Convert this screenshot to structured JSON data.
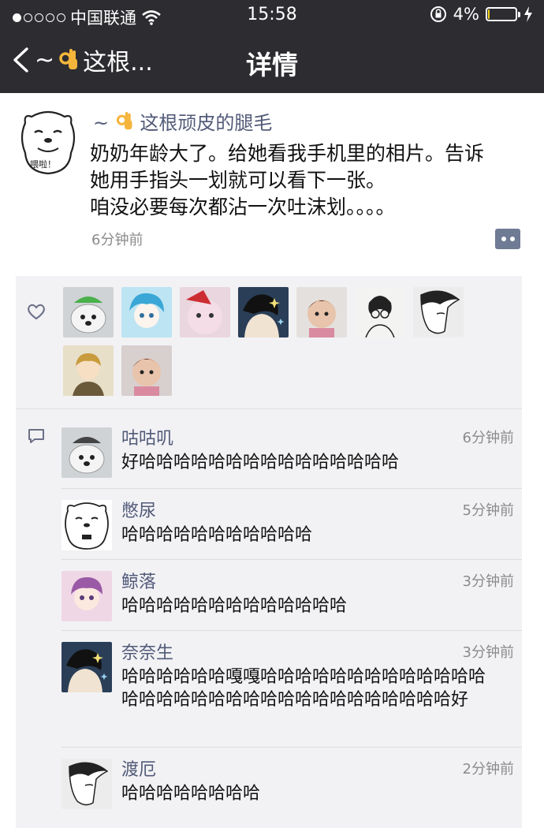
{
  "status_bar": {
    "carrier": "中国联通",
    "time": "15:58",
    "battery_percent": "4%",
    "battery_level": 0.04,
    "signal_bars_filled": 1,
    "signal_bars_total": 5,
    "icons": [
      "signal-dots-icon",
      "wifi-icon",
      "rotation-lock-icon",
      "battery-icon",
      "charging-bolt-icon"
    ]
  },
  "nav": {
    "back_prefix": "~",
    "back_label": "这根...",
    "title": "详情",
    "back_icon": "chevron-left-icon",
    "emoji_icon": "ok-hand-icon"
  },
  "post": {
    "author_prefix": "~",
    "author_name": "这根顽皮的腿毛",
    "avatar_text": "喂啦！",
    "lines": [
      "奶奶年龄大了。给她看我手机里的相片。告诉",
      "她用手指头一划就可以看下一张。",
      "咱没必要每次都沾一次吐沫划。。。。"
    ],
    "time": "6分钟前",
    "more_icon": "comment-more-icon"
  },
  "likes": {
    "icon": "heart-icon",
    "avatars": [
      {
        "name": "dog-green-hat-avatar",
        "bg": "#cfd3d6",
        "accent": "#49b04a"
      },
      {
        "name": "anime-blue-hair-avatar",
        "bg": "#bde4f2",
        "accent": "#3aa7d6"
      },
      {
        "name": "plush-bear-santa-avatar",
        "bg": "#ead6de",
        "accent": "#cc2d32"
      },
      {
        "name": "dark-hair-boy-avatar",
        "bg": "#2a3e57",
        "accent": "#e8d5c0"
      },
      {
        "name": "baby-photo-avatar",
        "bg": "#e4e0de",
        "accent": "#3b2c24"
      },
      {
        "name": "glasses-boy-sketch-avatar",
        "bg": "#f3f3f2",
        "accent": "#222222"
      },
      {
        "name": "anime-profile-avatar",
        "bg": "#ececec",
        "accent": "#2b2b2b"
      },
      {
        "name": "blonde-uniform-avatar",
        "bg": "#e8dfc8",
        "accent": "#c89b3c"
      },
      {
        "name": "child-photo-avatar",
        "bg": "#d8cfcf",
        "accent": "#5b3a33"
      }
    ]
  },
  "comments": {
    "icon": "comment-bubble-icon",
    "items": [
      {
        "name": "咕咕叽",
        "time": "6分钟前",
        "text": "好哈哈哈哈哈哈哈哈哈哈哈哈哈哈哈",
        "avatar": "dog-green-hat-avatar",
        "avatar_bg": "#cfd3d6"
      },
      {
        "name": "憋尿",
        "time": "5分钟前",
        "text": "哈哈哈哈哈哈哈哈哈哈哈",
        "avatar": "meme-bear-avatar",
        "avatar_bg": "#ffffff"
      },
      {
        "name": "鲸落",
        "time": "3分钟前",
        "text": "哈哈哈哈哈哈哈哈哈哈哈哈哈",
        "avatar": "anime-girl-pink-avatar",
        "avatar_bg": "#f0d7e6"
      },
      {
        "name": "奈奈生",
        "time": "3分钟前",
        "text": "哈哈哈哈哈哈嘎嘎哈哈哈哈哈哈哈哈哈哈哈哈哈哈哈哈哈哈哈哈哈哈哈哈哈哈哈哈哈哈哈哈好",
        "avatar": "dark-hair-boy-avatar",
        "avatar_bg": "#2a3e57"
      },
      {
        "name": "渡厄",
        "time": "2分钟前",
        "text": "哈哈哈哈哈哈哈哈",
        "avatar": "anime-profile-avatar",
        "avatar_bg": "#ececec"
      }
    ]
  },
  "colors": {
    "topbar": "#2c2c31",
    "name_blue": "#525a78",
    "muted": "#8b8b8b",
    "panel": "#f2f2f5",
    "battery": "#f2d21c"
  }
}
